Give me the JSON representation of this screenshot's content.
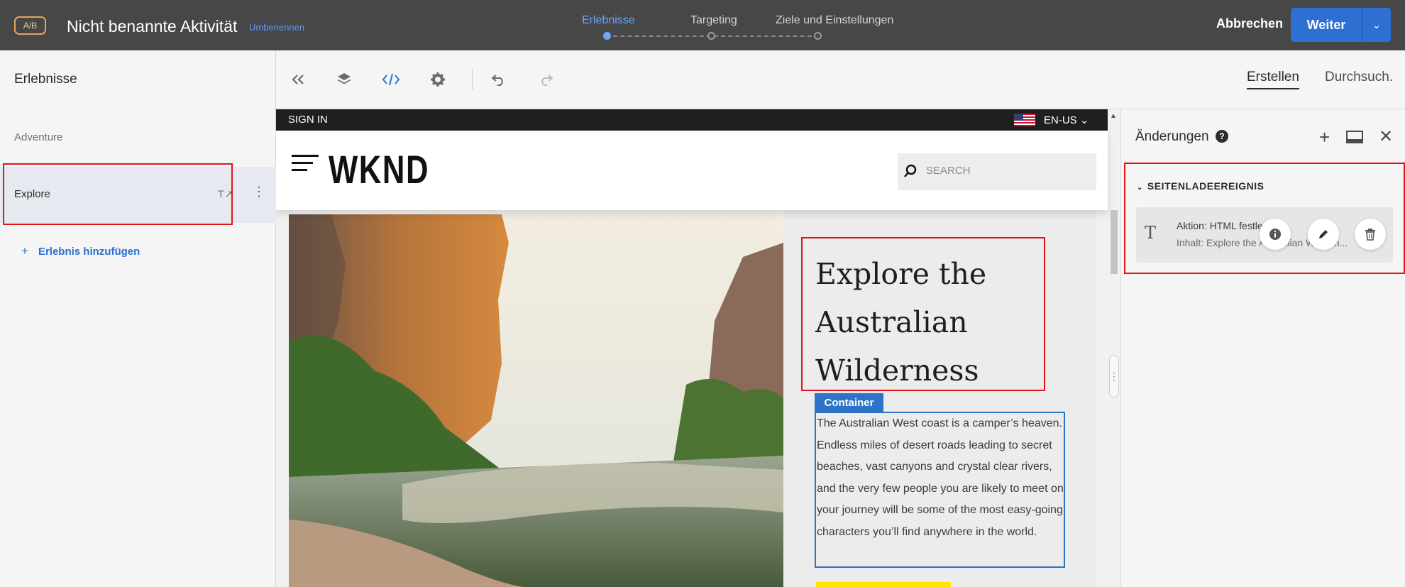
{
  "header": {
    "badge": "A/B",
    "activity_title": "Nicht benannte Aktivität",
    "rename_link": "Umbenennen",
    "steps": [
      {
        "label": "Erlebnisse",
        "active": true
      },
      {
        "label": "Targeting",
        "active": false
      },
      {
        "label": "Ziele und Einstellungen",
        "active": false
      }
    ],
    "cancel_label": "Abbrechen",
    "next_label": "Weiter",
    "accent_color": "#2d6fd2"
  },
  "sidebar": {
    "title": "Erlebnisse",
    "experiences": [
      {
        "label": "Adventure"
      },
      {
        "label": "Explore",
        "selected": true
      }
    ],
    "add_label": "Erlebnis hinzufügen",
    "add_icon": "+"
  },
  "toolbar": {
    "icons": [
      "collapse-icon",
      "layers-icon",
      "code-icon",
      "settings-icon",
      "undo-icon",
      "redo-icon"
    ],
    "tabs": [
      {
        "label": "Erstellen",
        "active": true
      },
      {
        "label": "Durchsuch.",
        "active": false
      }
    ]
  },
  "preview": {
    "sign_in": "SIGN IN",
    "language": "EN-US",
    "logo": "WKND",
    "search_placeholder": "SEARCH",
    "hero_title": "Explore the Australian Wilderness",
    "container_tag": "Container",
    "paragraph": "The Australian West coast is a camper’s heaven. Endless miles of desert roads leading to secret beaches, vast canyons and crystal clear rivers, and the very few people you are likely to meet on your journey will be some of the most easy-going characters you’ll find anywhere in the world."
  },
  "changes": {
    "title": "Änderungen",
    "help_icon": "?",
    "section_title": "SEITENLADEEREIGNIS",
    "card": {
      "action": "Aktion: HTML festlegen",
      "content": "Inhalt: Explore the Australian Wildern..."
    },
    "highlight_color": "#e3141a"
  }
}
